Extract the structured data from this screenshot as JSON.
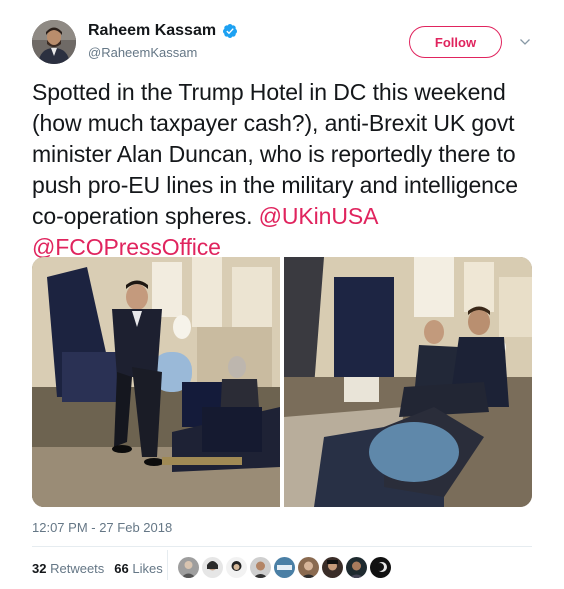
{
  "author": {
    "display_name": "Raheem Kassam",
    "handle": "@RaheemKassam",
    "verified_icon": "verified-badge-icon",
    "badge_color": "#1da1f2"
  },
  "follow_button": {
    "label": "Follow",
    "color": "#e0245e"
  },
  "menu": {
    "icon": "chevron-down-icon"
  },
  "tweet": {
    "text_part_1": "Spotted in the Trump Hotel in DC this weekend (how much taxpayer cash?), anti-Brexit UK govt minister Alan Duncan, who is reportedly there to push pro-EU lines in the military and intelligence co-operation spheres. ",
    "mention_1": "@UKinUSA",
    "mention_2": "@FCOPressOffice_",
    "mention_color": "#e0245e"
  },
  "timestamp": "12:07 PM - 27 Feb 2018",
  "stats": {
    "retweets_count": "32",
    "retweets_label": "Retweets",
    "likes_count": "66",
    "likes_label": "Likes"
  },
  "likers_count": 9
}
